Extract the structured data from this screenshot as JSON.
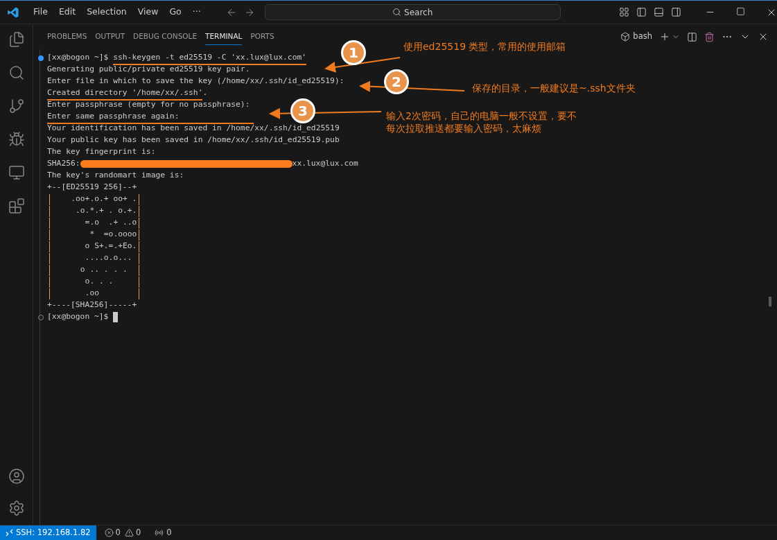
{
  "menu": [
    "File",
    "Edit",
    "Selection",
    "View",
    "Go",
    "···"
  ],
  "search": {
    "placeholder": "Search"
  },
  "panel_tabs": [
    {
      "label": "PROBLEMS",
      "selected": false
    },
    {
      "label": "OUTPUT",
      "selected": false
    },
    {
      "label": "DEBUG CONSOLE",
      "selected": false
    },
    {
      "label": "TERMINAL",
      "selected": true
    },
    {
      "label": "PORTS",
      "selected": false
    }
  ],
  "terminal_profile": "bash",
  "terminal_lines": [
    {
      "kind": "prompt",
      "prompt": "[xx@bogon ~]$ ",
      "text": "ssh-keygen -t ed25519 -C 'xx.lux@lux.com'",
      "underlined": true,
      "finished": true
    },
    {
      "kind": "output",
      "text": "Generating public/private ed25519 key pair.",
      "underlined": false
    },
    {
      "kind": "output",
      "text": "Enter file in which to save the key (/home/xx/.ssh/id_ed25519):",
      "underlined": false
    },
    {
      "kind": "output",
      "text": "Created directory '/home/xx/.ssh'",
      "tail": ".",
      "underlined": true
    },
    {
      "kind": "output",
      "text": "Enter passphrase (empty for no passphrase):",
      "underlined": false
    },
    {
      "kind": "output",
      "text": "Enter same passphrase again:",
      "underlined": true
    },
    {
      "kind": "output",
      "text": "Your identification has been saved in /home/xx/.ssh/id_ed25519",
      "underlined": false
    },
    {
      "kind": "output",
      "text": "Your public key has been saved in /home/xx/.ssh/id_ed25519.pub",
      "underlined": false
    },
    {
      "kind": "output",
      "text": "The key fingerprint is:",
      "underlined": false
    },
    {
      "kind": "redacted",
      "text": "SHA256:",
      "tail": "xx.lux@lux.com"
    },
    {
      "kind": "output",
      "text": "The key's randomart image is:",
      "underlined": false
    },
    {
      "kind": "output",
      "text": "+--[ED25519 256]--+",
      "underlined": false
    },
    {
      "kind": "art",
      "text": "    .oo+.o.+ oo+ ."
    },
    {
      "kind": "art",
      "text": "     .o.*.+ . o.+."
    },
    {
      "kind": "art",
      "text": "       =.o  .+ ..o"
    },
    {
      "kind": "art",
      "text": "        *  =o.oooo"
    },
    {
      "kind": "art",
      "text": "       o S+.=.+Eo."
    },
    {
      "kind": "art",
      "text": "       ....o.o... "
    },
    {
      "kind": "art",
      "text": "      o .. . . .  "
    },
    {
      "kind": "art",
      "text": "       o. . .     "
    },
    {
      "kind": "art",
      "text": "       .oo        "
    },
    {
      "kind": "output",
      "text": "+----[SHA256]-----+",
      "underlined": false
    },
    {
      "kind": "prompt",
      "prompt": "[xx@bogon ~]$ ",
      "finished": false
    }
  ],
  "annotations": [
    {
      "number": "1",
      "note": [
        "使用ed25519 类型，常用的使用邮箱"
      ]
    },
    {
      "number": "2",
      "note": [
        "保存的目录，一般建议是~.ssh文件夹"
      ]
    },
    {
      "number": "3",
      "note": [
        "输入2次密码，自己的电脑一般不设置，要不",
        "每次拉取推送都要输入密码，太麻烦"
      ]
    }
  ],
  "status_bar": {
    "remote": "SSH: 192.168.1.82",
    "errors": "0",
    "warnings": "0",
    "ports": "0"
  }
}
